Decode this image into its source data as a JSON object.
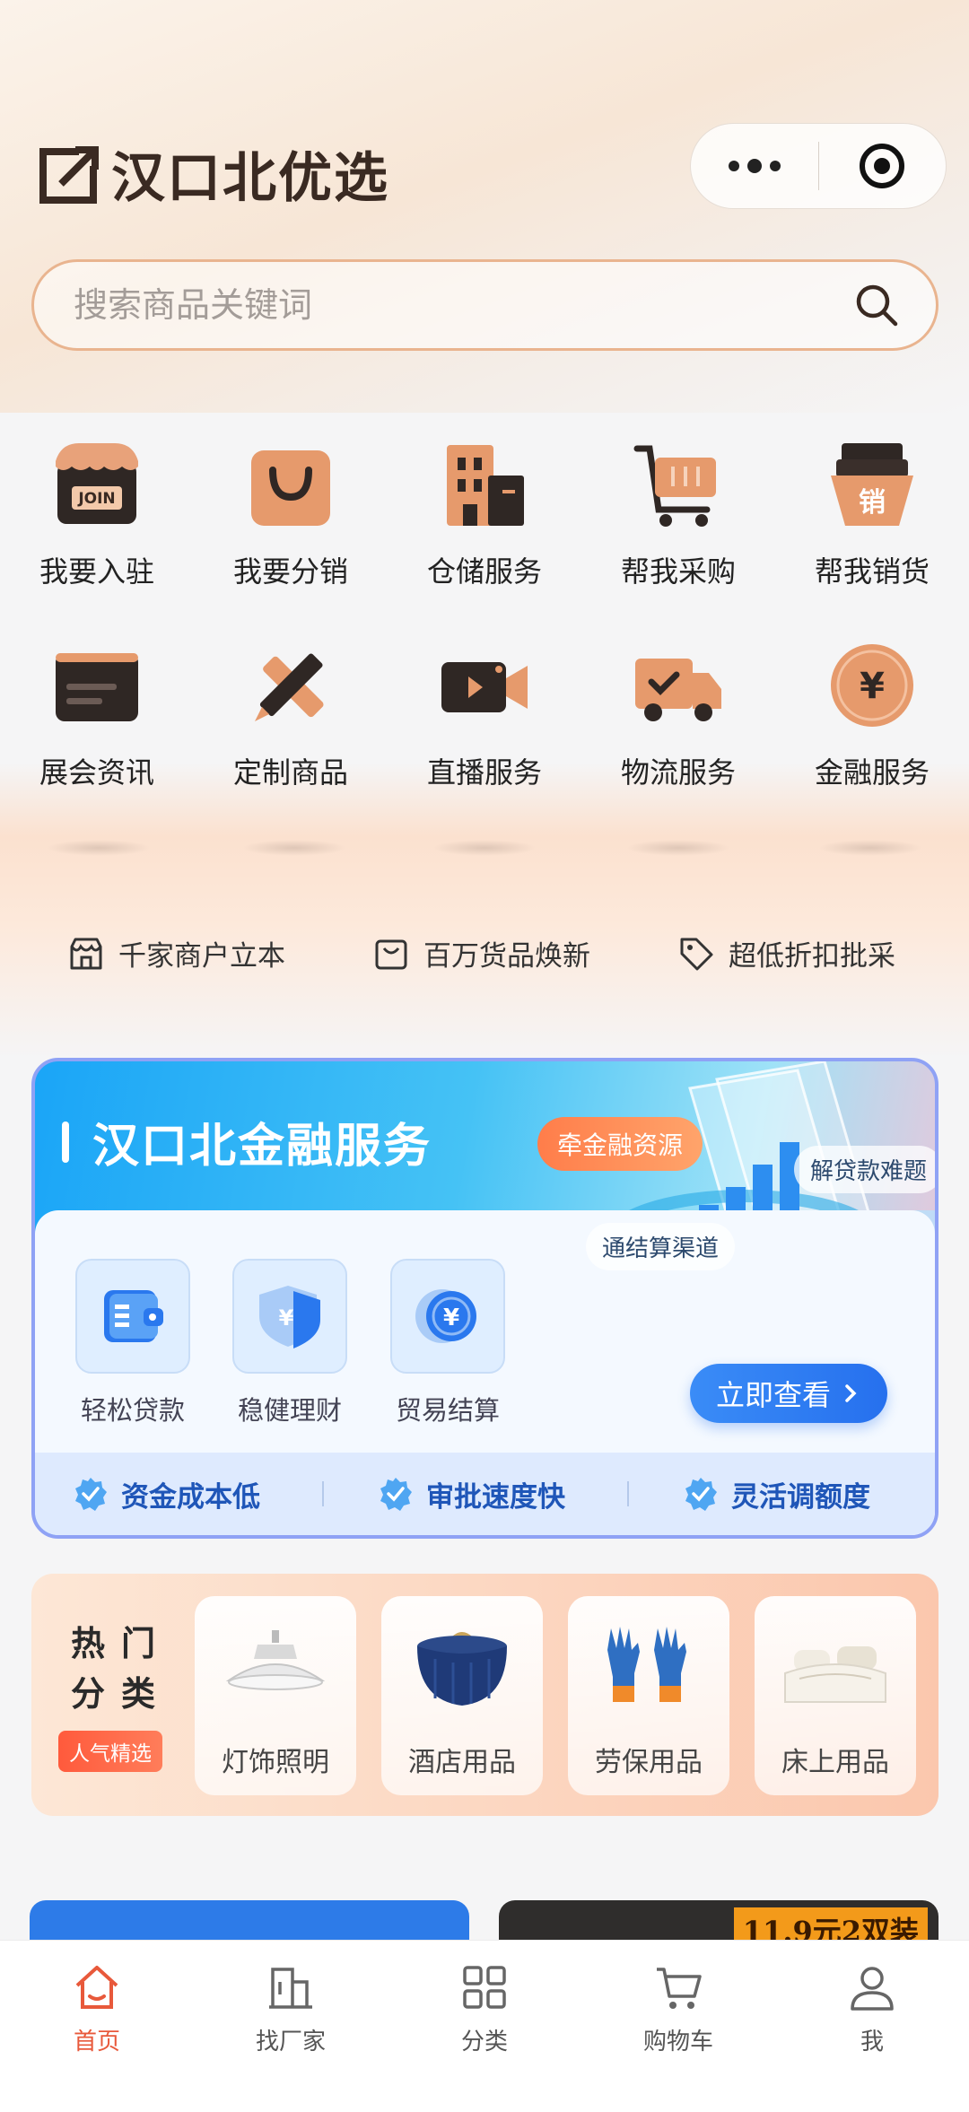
{
  "app": {
    "title": "汉口北优选"
  },
  "search": {
    "placeholder": "搜索商品关键词"
  },
  "services": [
    {
      "label": "我要入驻",
      "icon": "join-shop-icon"
    },
    {
      "label": "我要分销",
      "icon": "shopping-bag-icon"
    },
    {
      "label": "仓储服务",
      "icon": "warehouse-building-icon"
    },
    {
      "label": "帮我采购",
      "icon": "shopping-cart-icon"
    },
    {
      "label": "帮我销货",
      "icon": "sales-box-icon"
    },
    {
      "label": "展会资讯",
      "icon": "news-card-icon"
    },
    {
      "label": "定制商品",
      "icon": "ruler-pencil-icon"
    },
    {
      "label": "直播服务",
      "icon": "video-camera-icon"
    },
    {
      "label": "物流服务",
      "icon": "delivery-truck-icon"
    },
    {
      "label": "金融服务",
      "icon": "yuan-coin-icon"
    }
  ],
  "service_icon_text": {
    "join": "JOIN",
    "sell": "销"
  },
  "features": [
    {
      "label": "千家商户立本",
      "icon": "store-icon"
    },
    {
      "label": "百万货品焕新",
      "icon": "box-icon"
    },
    {
      "label": "超低折扣批采",
      "icon": "tag-icon"
    }
  ],
  "finance": {
    "title": "汉口北金融服务",
    "badge_main": "牵金融资源",
    "badge_loan": "解贷款难题",
    "badge_channel": "通结算渠道",
    "items": [
      {
        "label": "轻松贷款",
        "icon": "wallet-icon"
      },
      {
        "label": "稳健理财",
        "icon": "shield-yuan-icon"
      },
      {
        "label": "贸易结算",
        "icon": "yuan-coin-icon"
      }
    ],
    "cta": "立即查看",
    "benefits": [
      "资金成本低",
      "审批速度快",
      "灵活调额度"
    ],
    "yuan_symbol": "¥"
  },
  "hot": {
    "title_line1": "热门",
    "title_line2": "分类",
    "tag": "人气精选",
    "categories": [
      {
        "label": "灯饰照明",
        "icon": "ceiling-lamp-icon"
      },
      {
        "label": "酒店用品",
        "icon": "round-table-icon"
      },
      {
        "label": "劳保用品",
        "icon": "work-gloves-icon"
      },
      {
        "label": "床上用品",
        "icon": "bedding-icon"
      }
    ]
  },
  "promo": {
    "price_text": "11.9元2双装"
  },
  "tabbar": [
    {
      "label": "首页",
      "icon": "home-icon",
      "active": true
    },
    {
      "label": "找厂家",
      "icon": "factory-icon",
      "active": false
    },
    {
      "label": "分类",
      "icon": "grid-icon",
      "active": false
    },
    {
      "label": "购物车",
      "icon": "cart-icon",
      "active": false
    },
    {
      "label": "我",
      "icon": "user-icon",
      "active": false
    }
  ],
  "colors": {
    "accent_orange": "#e8593b",
    "finance_blue": "#2670ee",
    "search_border": "#e9b48f"
  }
}
